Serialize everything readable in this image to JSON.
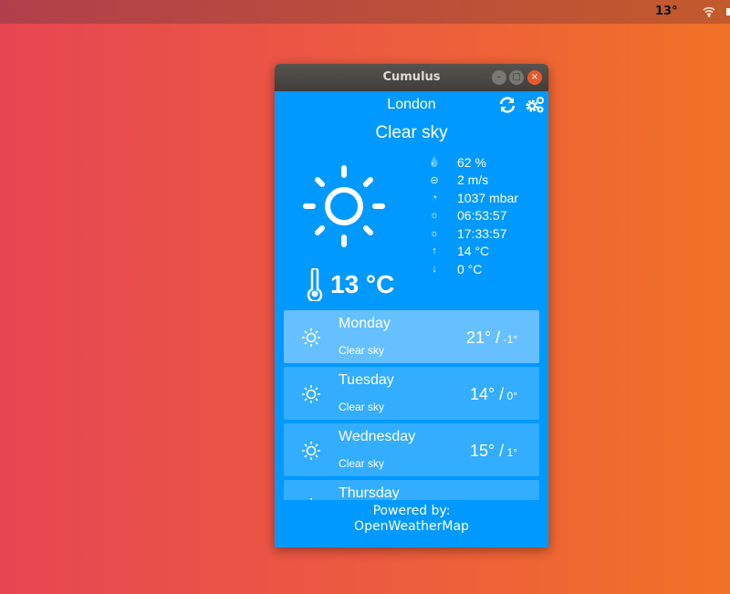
{
  "topbar": {
    "temperature": "13°",
    "wifi_icon": "wifi-icon"
  },
  "window": {
    "title": "Cumulus"
  },
  "current": {
    "city": "London",
    "description": "Clear sky",
    "temperature": "13 °C",
    "stats": [
      {
        "icon": "humidity-icon",
        "value": "62 %"
      },
      {
        "icon": "wind-icon",
        "value": "2 m/s"
      },
      {
        "icon": "pressure-icon",
        "value": "1037 mbar"
      },
      {
        "icon": "sunrise-icon",
        "value": "06:53:57"
      },
      {
        "icon": "sunset-icon",
        "value": "17:33:57"
      },
      {
        "icon": "arrow-up-icon",
        "value": "14 °C"
      },
      {
        "icon": "arrow-down-icon",
        "value": "0 °C"
      }
    ]
  },
  "forecast": [
    {
      "day": "Monday",
      "description": "Clear sky",
      "high": "21° /",
      "low": " -1°"
    },
    {
      "day": "Tuesday",
      "description": "Clear sky",
      "high": "14° /",
      "low": " 0°"
    },
    {
      "day": "Wednesday",
      "description": "Clear sky",
      "high": "15° /",
      "low": " 1°"
    },
    {
      "day": "Thursday",
      "description": "",
      "high": "",
      "low": ""
    }
  ],
  "footer": {
    "line1": "Powered by:",
    "line2": "OpenWeatherMap"
  },
  "colors": {
    "accent": "#0099ff",
    "card": "#33adff",
    "card_selected": "#66c0ff"
  }
}
